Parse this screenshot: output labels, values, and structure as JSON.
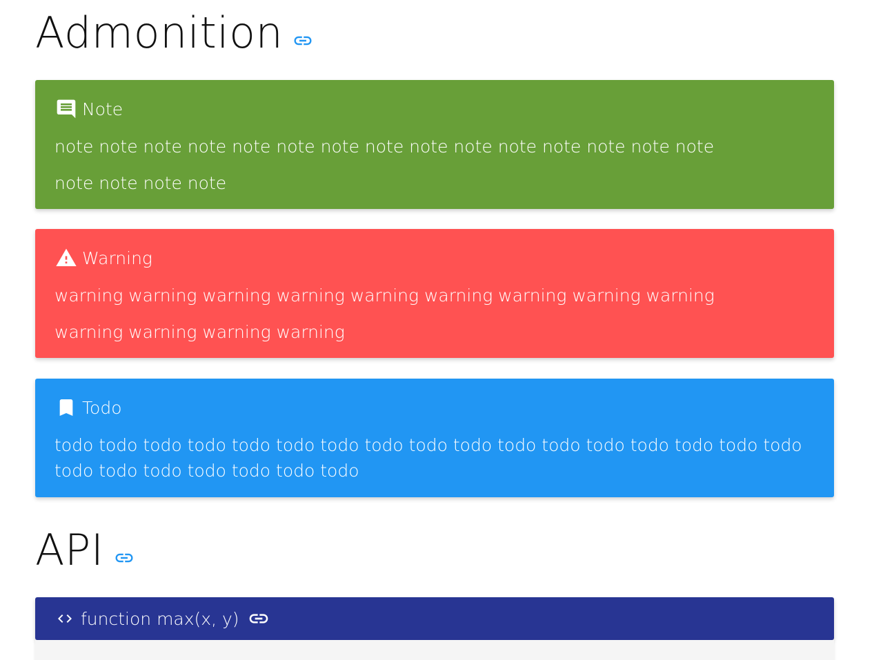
{
  "admonition_section": {
    "heading": "Admonition",
    "link_icon": "link-icon",
    "link_color": "#2196f3"
  },
  "admonitions": [
    {
      "type": "note",
      "icon": "comment-icon",
      "title": "Note",
      "color": "#689f38",
      "paragraphs": [
        "note note note note note note note note note note note note note note note",
        "note note note note"
      ]
    },
    {
      "type": "warning",
      "icon": "warning-icon",
      "title": "Warning",
      "color": "#ff5252",
      "paragraphs": [
        "warning warning warning warning warning warning warning warning warning",
        "warning warning warning warning"
      ]
    },
    {
      "type": "todo",
      "icon": "bookmark-icon",
      "title": "Todo",
      "color": "#2196f3",
      "paragraphs": [
        "todo todo todo todo todo todo todo todo todo todo todo todo todo todo todo todo todo todo todo todo todo todo todo todo"
      ]
    }
  ],
  "api_section": {
    "heading": "API",
    "link_icon": "link-icon",
    "function_signature": "function max(x, y)",
    "code_icon": "code-icon",
    "color": "#283593"
  }
}
